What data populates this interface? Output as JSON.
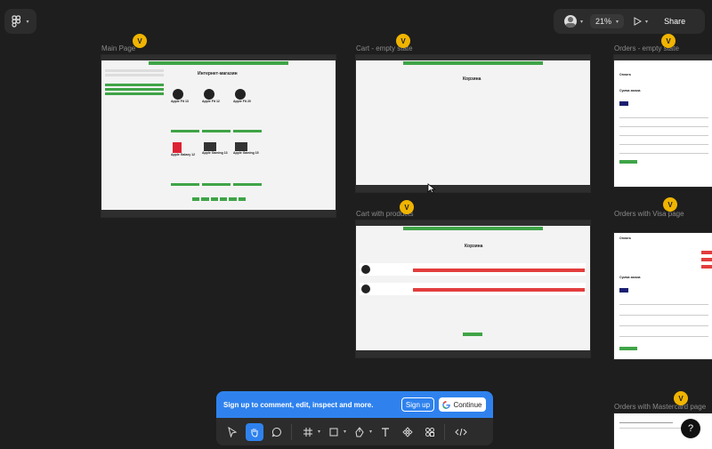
{
  "toolbar_top": {
    "zoom": "21%",
    "share_label": "Share"
  },
  "frames": [
    {
      "label": "Main Page",
      "badge": "V"
    },
    {
      "label": "Cart - empty state",
      "badge": "V"
    },
    {
      "label": "Orders - empty state",
      "badge": "V"
    },
    {
      "label": "Cart with products",
      "badge": "V"
    },
    {
      "label": "Orders with Visa page",
      "badge": "V"
    },
    {
      "label": "Orders with Mastercard page",
      "badge": "V"
    }
  ],
  "main_page": {
    "title": "Интернет-магазин",
    "products": [
      "Apple Fit 13",
      "Apple Fit 12",
      "Apple Fit 20",
      "Apple Galaxy 12",
      "Apple Gaming 13",
      "Apple Gaming 15"
    ]
  },
  "cart_empty": {
    "title": "Корзина"
  },
  "cart_products": {
    "title": "Корзина"
  },
  "orders_empty": {
    "title": "Оплата",
    "subtitle": "Сумма заказа"
  },
  "orders_visa": {
    "title": "Оплата",
    "subtitle": "Сумма заказа"
  },
  "signup": {
    "text": "Sign up to comment, edit, inspect and more.",
    "signup_label": "Sign up",
    "continue_label": "Continue"
  },
  "help_label": "?"
}
